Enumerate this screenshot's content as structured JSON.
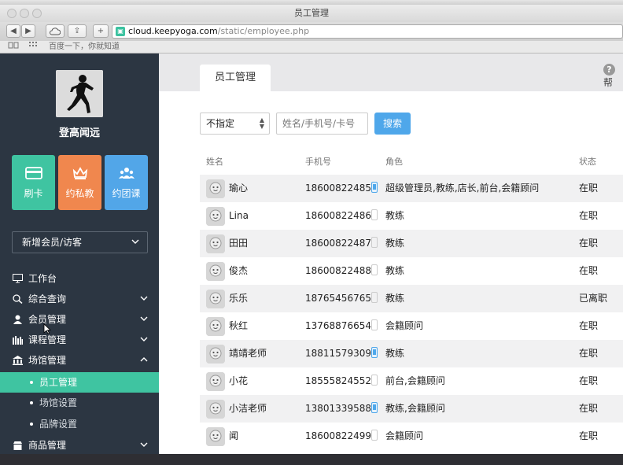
{
  "browser": {
    "window_title": "员工管理",
    "url_host": "cloud.keepyoga.com",
    "url_path": "/static/employee.php",
    "bookmark_text": "百度一下，你就知道"
  },
  "sidebar": {
    "brand_name": "登高闻远",
    "quick_actions": [
      {
        "label": "刷卡",
        "color": "#3fc4a1",
        "icon": "card-icon"
      },
      {
        "label": "约私教",
        "color": "#f0874e",
        "icon": "crown-icon"
      },
      {
        "label": "约团课",
        "color": "#52a6e8",
        "icon": "group-icon"
      }
    ],
    "new_member_dropdown": "新增会员/访客",
    "nav": [
      {
        "label": "工作台",
        "icon": "monitor-icon"
      },
      {
        "label": "综合查询",
        "icon": "search-icon"
      },
      {
        "label": "会员管理",
        "icon": "user-icon"
      },
      {
        "label": "课程管理",
        "icon": "course-icon"
      },
      {
        "label": "场馆管理",
        "icon": "venue-icon"
      },
      {
        "label": "员工管理",
        "icon": "dot"
      },
      {
        "label": "场馆设置",
        "icon": "dot"
      },
      {
        "label": "品牌设置",
        "icon": "dot"
      },
      {
        "label": "商品管理",
        "icon": "shop-icon"
      }
    ]
  },
  "main": {
    "tab_label": "员工管理",
    "help_label": "帮",
    "filter_select_value": "不指定",
    "search_placeholder": "姓名/手机号/卡号",
    "search_button": "搜索",
    "columns": {
      "name": "姓名",
      "phone": "手机号",
      "role": "角色",
      "status": "状态"
    },
    "rows": [
      {
        "name": "瑜心",
        "phone": "18600822485",
        "device_bound": true,
        "role": "超级管理员,教练,店长,前台,会籍顾问",
        "status": "在职"
      },
      {
        "name": "Lina",
        "phone": "18600822486",
        "device_bound": false,
        "role": "教练",
        "status": "在职"
      },
      {
        "name": "田田",
        "phone": "18600822487",
        "device_bound": false,
        "role": "教练",
        "status": "在职"
      },
      {
        "name": "俊杰",
        "phone": "18600822488",
        "device_bound": false,
        "role": "教练",
        "status": "在职"
      },
      {
        "name": "乐乐",
        "phone": "18765456765",
        "device_bound": false,
        "role": "教练",
        "status": "已离职"
      },
      {
        "name": "秋红",
        "phone": "13768876654",
        "device_bound": false,
        "role": "会籍顾问",
        "status": "在职"
      },
      {
        "name": "靖靖老师",
        "phone": "18811579309",
        "device_bound": true,
        "role": "教练",
        "status": "在职"
      },
      {
        "name": "小花",
        "phone": "18555824552",
        "device_bound": false,
        "role": "前台,会籍顾问",
        "status": "在职"
      },
      {
        "name": "小洁老师",
        "phone": "13801339588",
        "device_bound": true,
        "role": "教练,会籍顾问",
        "status": "在职"
      },
      {
        "name": "闻",
        "phone": "18600822499",
        "device_bound": false,
        "role": "会籍顾问",
        "status": "在职"
      }
    ]
  },
  "colors": {
    "sidebar_bg": "#2c3642",
    "accent_green": "#3fc4a1",
    "accent_orange": "#f0874e",
    "accent_blue": "#52a6e8",
    "search_button": "#4fa7ea"
  }
}
